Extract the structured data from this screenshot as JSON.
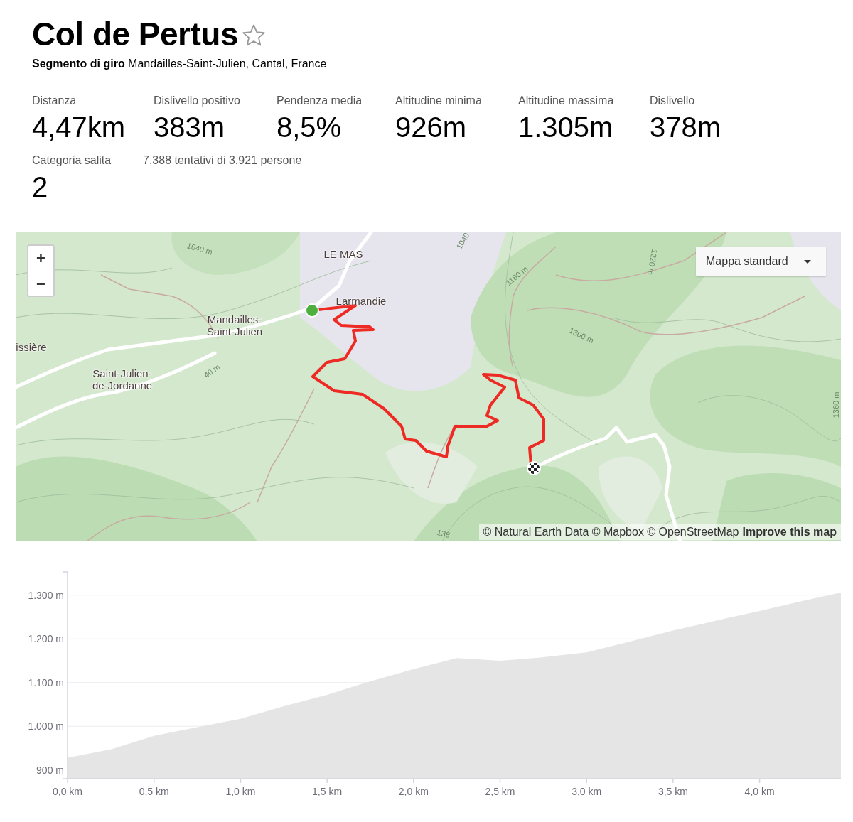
{
  "title": "Col de Pertus",
  "subtitle": "**Segmento di giro** Mandailles-Saint-Julien, Cantal, France",
  "stats": [
    {
      "label": "Distanza",
      "value": "4,47km"
    },
    {
      "label": "Dislivello positivo",
      "value": "383m"
    },
    {
      "label": "Pendenza media",
      "value": "8,5%"
    },
    {
      "label": "Altitudine minima",
      "value": "926m"
    },
    {
      "label": "Altitudine massima",
      "value": "1.305m"
    },
    {
      "label": "Dislivello",
      "value": "378m"
    }
  ],
  "climb_category": {
    "label": "Categoria salita",
    "value": "2"
  },
  "attempts": "7.388 tentativi di 3.921 persone",
  "map": {
    "zoom_in": "+",
    "zoom_out": "−",
    "style_dropdown": "Mappa standard",
    "labels": [
      {
        "text": "1040 m",
        "kind": "contour"
      },
      {
        "text": "LE MAS",
        "kind": "place"
      },
      {
        "text": "Larmandie",
        "kind": "place"
      },
      {
        "text": "Mandailles-Saint-Julien",
        "kind": "place"
      },
      {
        "text": "issière",
        "kind": "place"
      },
      {
        "text": "Saint-Julien-de-Jordanne",
        "kind": "place"
      },
      {
        "text": "40 m",
        "kind": "contour"
      },
      {
        "text": "1040",
        "kind": "contour"
      },
      {
        "text": "1180 m",
        "kind": "contour"
      },
      {
        "text": "1220 m",
        "kind": "contour"
      },
      {
        "text": "1300 m",
        "kind": "contour"
      },
      {
        "text": "1360 m",
        "kind": "contour"
      },
      {
        "text": "138",
        "kind": "contour"
      }
    ],
    "attribution": {
      "text": "© Natural Earth Data © Mapbox © OpenStreetMap",
      "link": "Improve this map"
    }
  },
  "elevation_profile": {
    "chart_data": {
      "type": "area",
      "x": [
        0,
        0.25,
        0.5,
        0.75,
        1.0,
        1.25,
        1.5,
        1.75,
        2.0,
        2.25,
        2.5,
        2.75,
        3.0,
        3.25,
        3.5,
        3.75,
        4.0,
        4.25,
        4.47
      ],
      "values": [
        928,
        947,
        978,
        998,
        1017,
        1046,
        1072,
        1103,
        1131,
        1156,
        1150,
        1158,
        1169,
        1194,
        1219,
        1242,
        1264,
        1287,
        1306
      ],
      "xlim": [
        0,
        4.47
      ],
      "ylim": [
        880,
        1350
      ],
      "grid": true,
      "xticks": [
        {
          "value": 0,
          "label": "0,0 km"
        },
        {
          "value": 0.5,
          "label": "0,5 km"
        },
        {
          "value": 1.0,
          "label": "1,0 km"
        },
        {
          "value": 1.5,
          "label": "1,5 km"
        },
        {
          "value": 2.0,
          "label": "2,0 km"
        },
        {
          "value": 2.5,
          "label": "2,5 km"
        },
        {
          "value": 3.0,
          "label": "3,0 km"
        },
        {
          "value": 3.5,
          "label": "3,5 km"
        },
        {
          "value": 4.0,
          "label": "4,0 km"
        }
      ],
      "yticks": [
        {
          "value": 900,
          "label": "900 m"
        },
        {
          "value": 1000,
          "label": "1.000 m"
        },
        {
          "value": 1100,
          "label": "1.100 m"
        },
        {
          "value": 1200,
          "label": "1.200 m"
        },
        {
          "value": 1300,
          "label": "1.300 m"
        }
      ]
    }
  }
}
